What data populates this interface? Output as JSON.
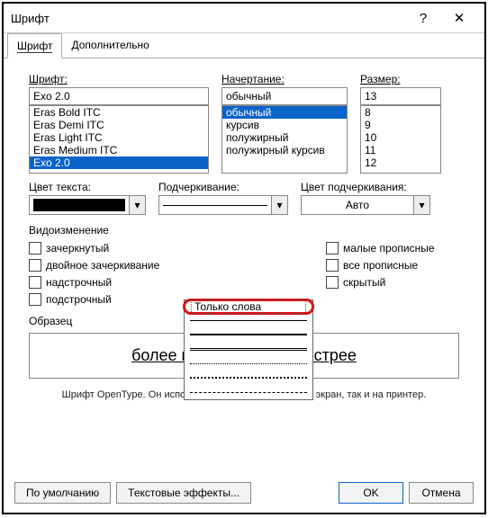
{
  "window": {
    "title": "Шрифт"
  },
  "tabs": {
    "t0": "Шрифт",
    "t1": "Дополнительно"
  },
  "font": {
    "label": "Шрифт:",
    "value": "Exo 2.0",
    "list": [
      "Eras Bold ITC",
      "Eras Demi ITC",
      "Eras Light ITC",
      "Eras Medium ITC",
      "Exo 2.0"
    ]
  },
  "style": {
    "label": "Начертание:",
    "value": "обычный",
    "list": [
      "обычный",
      "курсив",
      "полужирный",
      "полужирный курсив"
    ]
  },
  "size": {
    "label": "Размер:",
    "value": "13",
    "list": [
      "8",
      "9",
      "10",
      "11",
      "12"
    ]
  },
  "color": {
    "label": "Цвет текста:"
  },
  "underline": {
    "label": "Подчеркивание:"
  },
  "ucolor": {
    "label": "Цвет подчеркивания:",
    "value": "Авто"
  },
  "effects": {
    "group": "Видоизменение",
    "c0": "зачеркнутый",
    "c1": "двойное зачеркивание",
    "c2": "надстрочный",
    "c3": "подстрочный",
    "c4": "малые прописные",
    "c5": "все прописные",
    "c6": "скрытый"
  },
  "dropdown": {
    "only_words": "Только слова"
  },
  "preview": {
    "label": "Образец",
    "sample": "более качественно и быстрее"
  },
  "note": "Шрифт OpenType. Он используется для вывода как на экран, так и на принтер.",
  "buttons": {
    "default": "По умолчанию",
    "effects": "Текстовые эффекты...",
    "ok": "OK",
    "cancel": "Отмена"
  }
}
